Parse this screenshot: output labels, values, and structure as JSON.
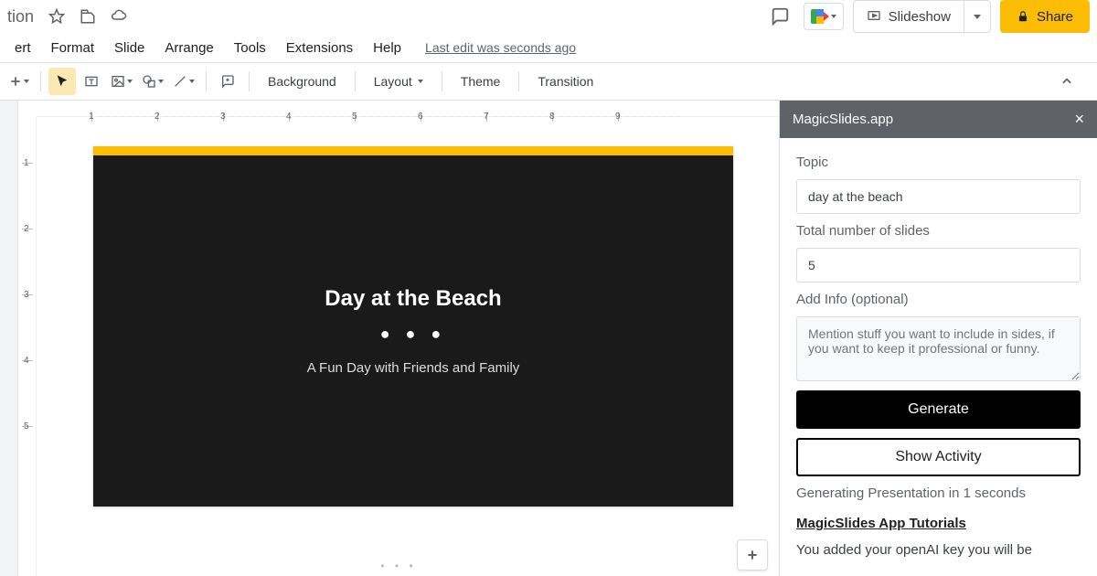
{
  "topbar": {
    "title_fragment": "tion",
    "slideshow_label": "Slideshow",
    "share_label": "Share"
  },
  "menu": {
    "items": [
      "ert",
      "Format",
      "Slide",
      "Arrange",
      "Tools",
      "Extensions",
      "Help"
    ],
    "last_edit": "Last edit was seconds ago"
  },
  "toolbar": {
    "background": "Background",
    "layout": "Layout",
    "theme": "Theme",
    "transition": "Transition"
  },
  "ruler": {
    "h": [
      "1",
      "2",
      "3",
      "4",
      "5",
      "6",
      "7",
      "8",
      "9"
    ],
    "v": [
      "1",
      "2",
      "3",
      "4",
      "5"
    ]
  },
  "slide": {
    "title": "Day at the Beach",
    "dots": "● ● ●",
    "subtitle": "A Fun Day with Friends and Family"
  },
  "sidebar": {
    "title": "MagicSlides.app",
    "topic_label": "Topic",
    "topic_value": "day at the beach",
    "slides_label": "Total number of slides",
    "slides_value": "5",
    "addinfo_label": "Add Info (optional)",
    "addinfo_placeholder": "Mention stuff you want to include in sides, if you want to keep it professional or funny.",
    "generate_label": "Generate",
    "show_activity_label": "Show Activity",
    "status": "Generating Presentation in 1 seconds",
    "tutorials": "MagicSlides App Tutorials",
    "note": "You added your openAI key you will be"
  }
}
